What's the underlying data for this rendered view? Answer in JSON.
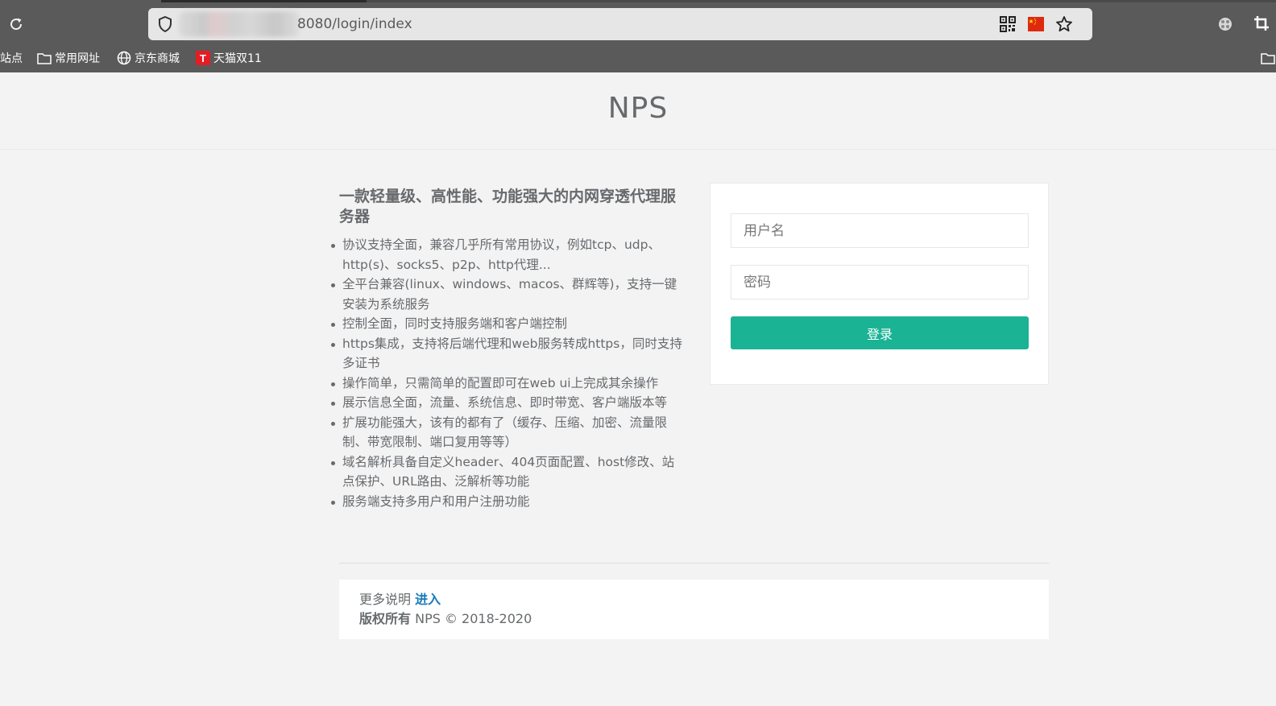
{
  "browser": {
    "url_suffix": "8080/login/index",
    "bookmarks": [
      {
        "label": "站点",
        "icon": "none"
      },
      {
        "label": "常用网址",
        "icon": "folder-icon"
      },
      {
        "label": "京东商城",
        "icon": "globe-icon"
      },
      {
        "label": "天猫双11",
        "icon": "tmall-icon",
        "badge": "T"
      }
    ]
  },
  "page": {
    "title": "NPS",
    "intro_heading": "一款轻量级、高性能、功能强大的内网穿透代理服务器",
    "features": [
      "协议支持全面，兼容几乎所有常用协议，例如tcp、udp、http(s)、socks5、p2p、http代理...",
      "全平台兼容(linux、windows、macos、群辉等)，支持一键安装为系统服务",
      "控制全面，同时支持服务端和客户端控制",
      "https集成，支持将后端代理和web服务转成https，同时支持多证书",
      "操作简单，只需简单的配置即可在web ui上完成其余操作",
      "展示信息全面，流量、系统信息、即时带宽、客户端版本等",
      "扩展功能强大，该有的都有了（缓存、压缩、加密、流量限制、带宽限制、端口复用等等）",
      "域名解析具备自定义header、404页面配置、host修改、站点保护、URL路由、泛解析等功能",
      "服务端支持多用户和用户注册功能"
    ]
  },
  "login": {
    "username_placeholder": "用户名",
    "password_placeholder": "密码",
    "submit_label": "登录"
  },
  "footer": {
    "more_text": "更多说明",
    "more_link": "进入",
    "copyright_label": "版权所有",
    "copyright_text": "NPS © 2018-2020"
  },
  "colors": {
    "accent": "#1ab394",
    "link": "#1a7bb9",
    "flag": "#de2910"
  }
}
